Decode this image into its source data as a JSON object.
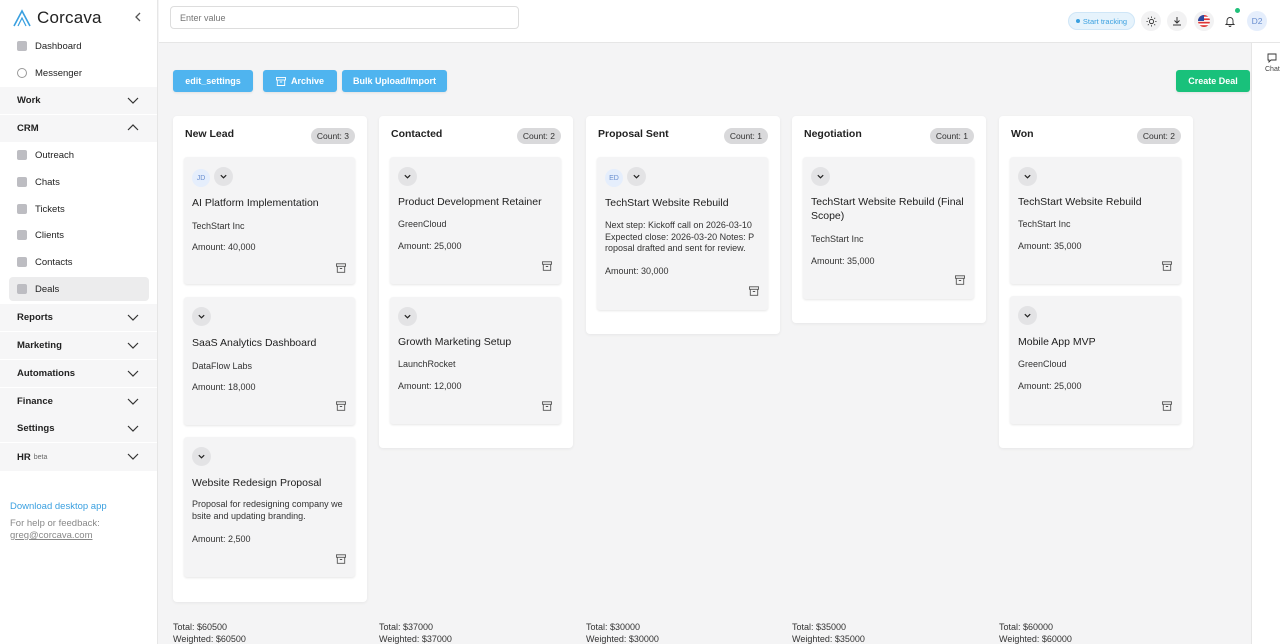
{
  "app": {
    "name": "Corcava"
  },
  "sidebar": {
    "top_items": [
      {
        "label": "Dashboard"
      },
      {
        "label": "Messenger"
      }
    ],
    "groups": {
      "work": "Work",
      "crm": "CRM",
      "reports": "Reports",
      "marketing": "Marketing",
      "automations": "Automations",
      "finance": "Finance",
      "settings": "Settings",
      "hr": "HR",
      "hr_badge": "beta"
    },
    "crm_items": [
      {
        "label": "Outreach"
      },
      {
        "label": "Chats"
      },
      {
        "label": "Tickets"
      },
      {
        "label": "Clients"
      },
      {
        "label": "Contacts"
      },
      {
        "label": "Deals"
      }
    ],
    "download_link": "Download desktop app",
    "help_text": "For help or feedback:",
    "help_email": "greg@corcava.com"
  },
  "topbar": {
    "search_placeholder": "Enter value",
    "tracking_label": "Start tracking",
    "avatar_initials": "D2"
  },
  "chat_rail": {
    "label": "Chat"
  },
  "actions": {
    "edit_settings": "edit_settings",
    "archive": "Archive",
    "bulk_upload": "Bulk Upload/Import",
    "create_deal": "Create Deal"
  },
  "columns": [
    {
      "title": "New Lead",
      "count": "Count: 3",
      "total": "Total: $60500",
      "weighted": "Weighted: $60500",
      "cards": [
        {
          "initials": "JD",
          "title": "AI Platform Implementation",
          "company": "TechStart Inc",
          "amount": "Amount: 40,000"
        },
        {
          "title": "SaaS Analytics Dashboard",
          "company": "DataFlow Labs",
          "amount": "Amount: 18,000"
        },
        {
          "title": "Website Redesign Proposal",
          "desc1": "Proposal for redesigning company we",
          "desc2": "bsite and updating branding.",
          "amount": "Amount: 2,500"
        }
      ]
    },
    {
      "title": "Contacted",
      "count": "Count: 2",
      "total": "Total: $37000",
      "weighted": "Weighted: $37000",
      "cards": [
        {
          "title": "Product Development Retainer",
          "company": "GreenCloud",
          "amount": "Amount: 25,000"
        },
        {
          "title": "Growth Marketing Setup",
          "company": "LaunchRocket",
          "amount": "Amount: 12,000"
        }
      ]
    },
    {
      "title": "Proposal Sent",
      "count": "Count: 1",
      "total": "Total: $30000",
      "weighted": "Weighted: $30000",
      "cards": [
        {
          "initials": "ED",
          "title": "TechStart Website Rebuild",
          "desc1": "Next step: Kickoff call on 2026-03-10",
          "desc2": "Expected close: 2026-03-20 Notes: P",
          "desc3": "roposal drafted and sent for review.",
          "amount": "Amount: 30,000"
        }
      ]
    },
    {
      "title": "Negotiation",
      "count": "Count: 1",
      "total": "Total: $35000",
      "weighted": "Weighted: $35000",
      "cards": [
        {
          "title1": "TechStart Website Rebuild (Final",
          "title2": "Scope)",
          "company": "TechStart Inc",
          "amount": "Amount: 35,000"
        }
      ]
    },
    {
      "title": "Won",
      "count": "Count: 2",
      "total": "Total: $60000",
      "weighted": "Weighted: $60000",
      "cards": [
        {
          "title": "TechStart Website Rebuild",
          "company": "TechStart Inc",
          "amount": "Amount: 35,000"
        },
        {
          "title": "Mobile App MVP",
          "company": "GreenCloud",
          "amount": "Amount: 25,000"
        }
      ]
    }
  ],
  "colors": {
    "accent": "#4fb4ef",
    "success": "#19c17b",
    "link": "#3aa0e0"
  },
  "icons": [
    "corcava-logo-icon",
    "chevron-left-icon",
    "chevron-down-icon",
    "chevron-up-icon",
    "archive-icon",
    "sun-icon",
    "download-icon",
    "flag-us-icon",
    "bell-icon",
    "chat-icon"
  ]
}
